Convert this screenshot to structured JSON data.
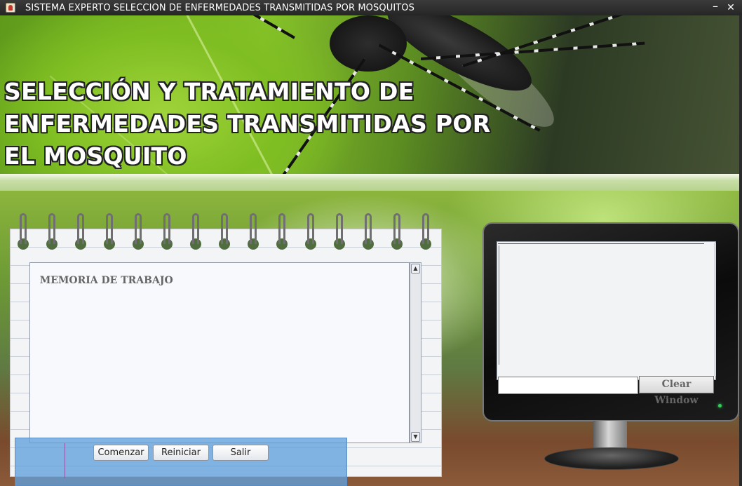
{
  "window": {
    "title": "SISTEMA EXPERTO SELECCION DE ENFERMEDADES TRANSMITIDAS POR MOSQUITOS",
    "minimize_glyph": "–",
    "close_glyph": "✕"
  },
  "banner": {
    "title_lines": [
      "SELECCIÓN Y TRATAMIENTO DE",
      "ENFERMEDADES TRANSMITIDAS POR",
      "EL MOSQUITO"
    ]
  },
  "memory": {
    "label": "MEMORIA DE TRABAJO",
    "scroll_up_glyph": "▲",
    "scroll_down_glyph": "▼"
  },
  "buttons": {
    "start": "Comenzar",
    "reset": "Reiniciar",
    "exit": "Salir"
  },
  "console": {
    "input_value": "",
    "clear_label": "Clear Window"
  },
  "icons": {
    "app": "java-cup-icon",
    "minimize": "minimize-icon",
    "close": "close-icon"
  }
}
